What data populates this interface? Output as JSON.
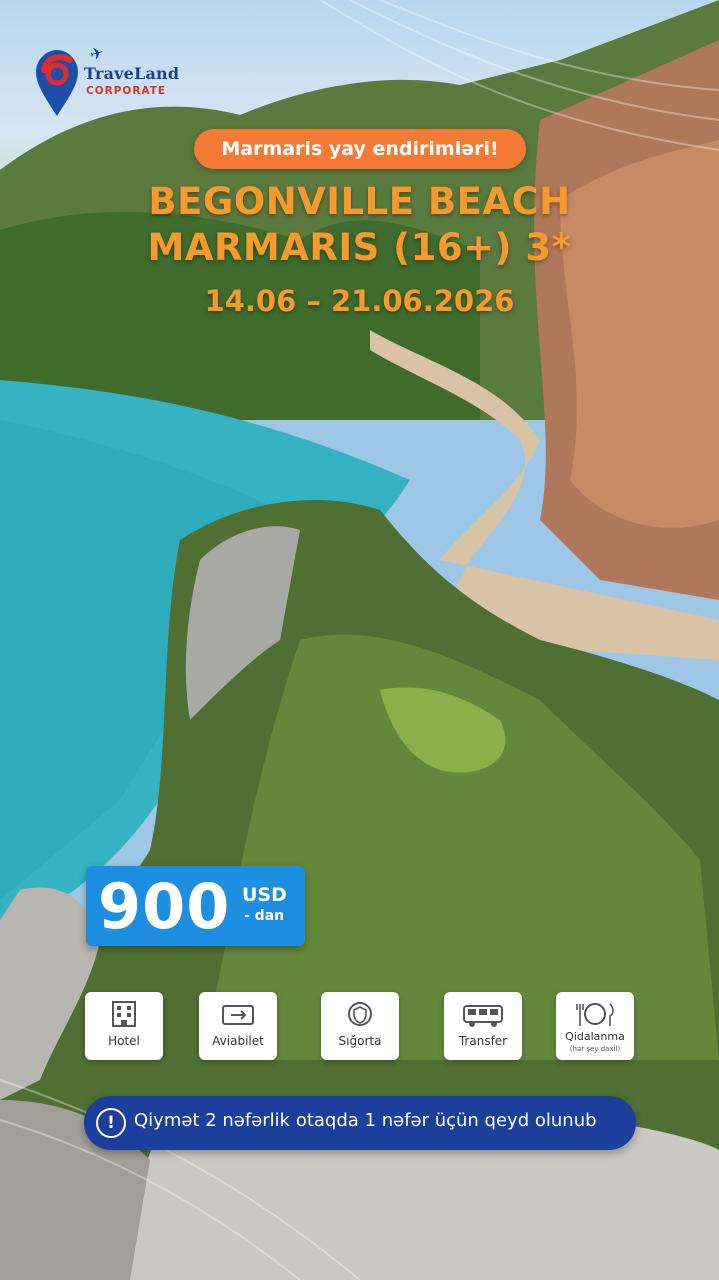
{
  "brand": {
    "name": "TraveLand",
    "sub": "CORPORATE"
  },
  "promo": {
    "label": "Marmaris yay endirimləri!"
  },
  "hotel": {
    "line1": "BEGONVILLE BEACH",
    "line2": "MARMARIS (16+) 3*"
  },
  "dates": "14.06 – 21.06.2026",
  "price": {
    "amount": "900",
    "currency": "USD",
    "from": "- dan"
  },
  "features": [
    {
      "label": "Hotel",
      "icon": "hotel-icon"
    },
    {
      "label": "Aviabilet",
      "icon": "ticket-icon"
    },
    {
      "label": "Sığorta",
      "icon": "insurance-icon"
    },
    {
      "label": "Transfer",
      "icon": "bus-icon"
    },
    {
      "label": "Qidalanma",
      "sub": "(hər şey daxil)",
      "icon": "dining-icon"
    }
  ],
  "info": {
    "text": "Qiymət 2 nəfərlik otaqda 1 nəfər üçün qeyd olunub"
  },
  "colors": {
    "accent": "#f47a35",
    "title": "#f79a2e",
    "price_bg": "#1e8ee0",
    "info_bg": "#1b3f9a"
  }
}
